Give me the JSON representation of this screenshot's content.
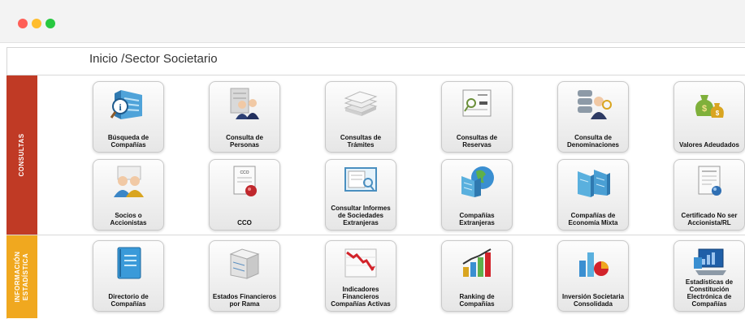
{
  "window": {
    "controls": [
      "close",
      "minimize",
      "maximize"
    ]
  },
  "breadcrumb": "Inicio /Sector Societario",
  "sections": {
    "consultas": {
      "label": "CONSULTAS",
      "color": "#c03a25"
    },
    "informacion": {
      "label": "INFORMACIÓN ESTADÍSTICA",
      "line1": "INFORMACIÓN",
      "line2": "ESTADÍSTICA",
      "color": "#f0a81f"
    }
  },
  "tiles": [
    {
      "label": "Búsqueda de Compañías",
      "icon": "building-search-icon"
    },
    {
      "label": "Consulta de Personas",
      "icon": "people-building-icon"
    },
    {
      "label": "Consultas de Trámites",
      "icon": "papers-stack-icon"
    },
    {
      "label": "Consultas de Reservas",
      "icon": "document-magnifier-icon"
    },
    {
      "label": "Consulta de Denominaciones",
      "icon": "server-person-icon"
    },
    {
      "label": "Valores Adeudados",
      "icon": "money-bags-icon"
    },
    {
      "label": "Socios o Accionistas",
      "icon": "partners-icon"
    },
    {
      "label": "CCO",
      "icon": "certificate-seal-icon"
    },
    {
      "label": "Consultar Informes de Sociedades Extranjeras",
      "icon": "document-screen-icon"
    },
    {
      "label": "Compañías Extranjeras",
      "icon": "globe-buildings-icon"
    },
    {
      "label": "Compañías de Economía Mixta",
      "icon": "twin-buildings-icon"
    },
    {
      "label": "Certificado No ser Accionista/RL",
      "icon": "certificate-doc-icon"
    },
    {
      "label": "Directorio de Compañías",
      "icon": "notebook-icon"
    },
    {
      "label": "Estados Financieros por Rama",
      "icon": "office-building-icon"
    },
    {
      "label": "Indicadores Financieros Compañías Activas",
      "icon": "decline-chart-icon"
    },
    {
      "label": "Ranking de Compañías",
      "icon": "bar-chart-icon"
    },
    {
      "label": "Inversión Societaria Consolidada",
      "icon": "bars-pie-icon"
    },
    {
      "label": "Estadísticas de Constitución Electrónica de Compañías",
      "icon": "laptop-stats-icon"
    }
  ]
}
